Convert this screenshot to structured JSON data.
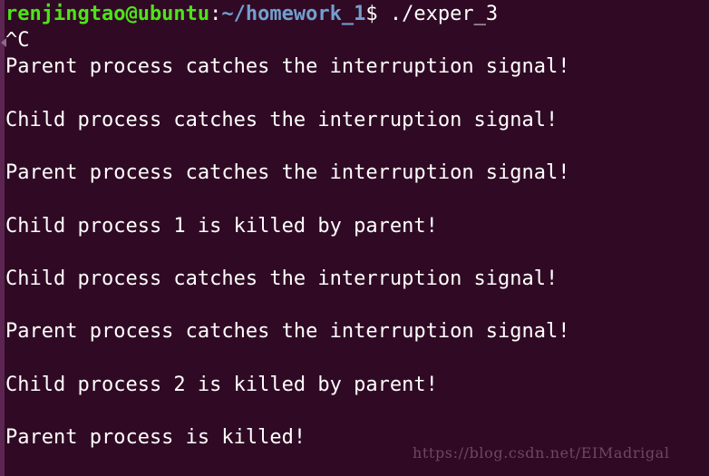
{
  "terminal": {
    "background_color": "#300a24",
    "foreground_color": "#ffffff",
    "scrollbar_color": "#5c2552",
    "prompt": {
      "user_host": "renjingtao@ubuntu",
      "user_host_color": "#4ee31a",
      "separator": ":",
      "path": "~/homework_1",
      "path_color": "#729fcf",
      "command": "$ ./exper_3"
    },
    "interrupt_echo": "^C",
    "output_lines": [
      "Parent process catches the interruption signal!",
      "",
      "Child process catches the interruption signal!",
      "",
      "Parent process catches the interruption signal!",
      "",
      "Child process 1 is killed by parent!",
      "",
      "Child process catches the interruption signal!",
      "",
      "Parent process catches the interruption signal!",
      "",
      "Child process 2 is killed by parent!",
      "",
      "Parent process is killed!"
    ]
  },
  "watermark": {
    "text": "https://blog.csdn.net/EIMadrigal",
    "color": "#6a4a60"
  }
}
